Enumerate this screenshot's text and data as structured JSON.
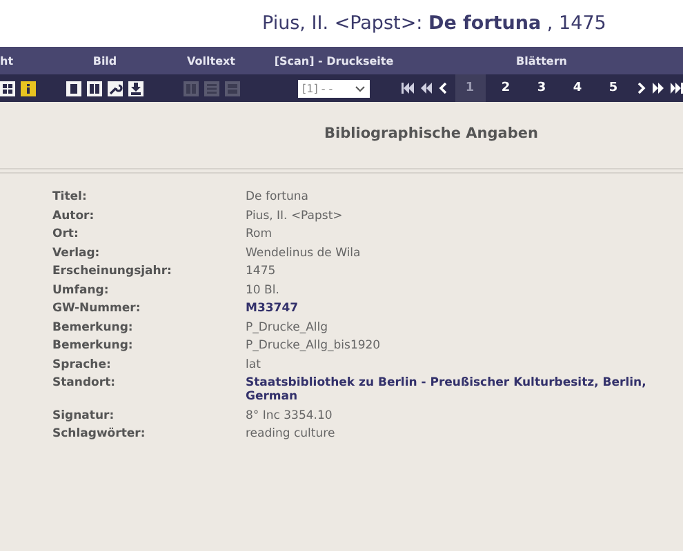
{
  "title": "Pius, II. <Papst>: **De fortuna** , 1475",
  "toolbar": {
    "groups": [
      {
        "label": "ht",
        "icons": [
          {
            "kind": "grid",
            "disabled": false,
            "highlighted": false
          },
          {
            "kind": "info",
            "disabled": false,
            "highlighted": true
          }
        ]
      },
      {
        "label": "Bild",
        "icons": [
          {
            "kind": "single",
            "disabled": false,
            "highlighted": false
          },
          {
            "kind": "double",
            "disabled": false,
            "highlighted": false
          },
          {
            "kind": "wrench",
            "disabled": false,
            "highlighted": false
          },
          {
            "kind": "pdf",
            "disabled": false,
            "highlighted": false
          }
        ]
      },
      {
        "label": "Volltext",
        "icons": [
          {
            "kind": "split",
            "disabled": true,
            "highlighted": false
          },
          {
            "kind": "lines",
            "disabled": true,
            "highlighted": false
          },
          {
            "kind": "block",
            "disabled": true,
            "highlighted": false
          }
        ]
      },
      {
        "label": "[Scan] - Druckseite",
        "select": "[1] - -"
      },
      {
        "label": "Blättern",
        "pager": [
          {
            "kind": "first"
          },
          {
            "kind": "fastback"
          },
          {
            "kind": "back"
          },
          {
            "kind": "page",
            "label": "1",
            "selected": true
          },
          {
            "kind": "page",
            "label": "2",
            "selected": false
          },
          {
            "kind": "page",
            "label": "3",
            "selected": false
          },
          {
            "kind": "page",
            "label": "4",
            "selected": false
          },
          {
            "kind": "page",
            "label": "5",
            "selected": false
          },
          {
            "kind": "next"
          },
          {
            "kind": "fastnext"
          },
          {
            "kind": "last"
          }
        ]
      }
    ]
  },
  "heading": "Bibliographische Angaben",
  "fields": [
    {
      "label": "Titel:",
      "value": "De fortuna",
      "emphasis": false
    },
    {
      "label": "Autor:",
      "value": "Pius, II. <Papst>",
      "emphasis": false
    },
    {
      "label": "Ort:",
      "value": "Rom",
      "emphasis": false
    },
    {
      "label": "Verlag:",
      "value": "Wendelinus de Wila",
      "emphasis": false
    },
    {
      "label": "Erscheinungsjahr:",
      "value": "1475",
      "emphasis": false
    },
    {
      "label": "Umfang:",
      "value": "10 Bl.",
      "emphasis": false
    },
    {
      "label": "GW-Nummer:",
      "value": "M33747",
      "emphasis": true
    },
    {
      "label": "Bemerkung:",
      "value": "P_Drucke_Allg",
      "emphasis": false
    },
    {
      "label": "Bemerkung:",
      "value": "P_Drucke_Allg_bis1920",
      "emphasis": false
    },
    {
      "label": "Sprache:",
      "value": "lat",
      "emphasis": false
    },
    {
      "label": "Standort:",
      "value": "Staatsbibliothek zu Berlin - Preußischer Kulturbesitz, Berlin, German",
      "emphasis": true
    },
    {
      "label": "Signatur:",
      "value": "8° Inc 3354.10",
      "emphasis": false
    },
    {
      "label": "Schlagwörter:",
      "value": "reading culture",
      "emphasis": false
    }
  ]
}
